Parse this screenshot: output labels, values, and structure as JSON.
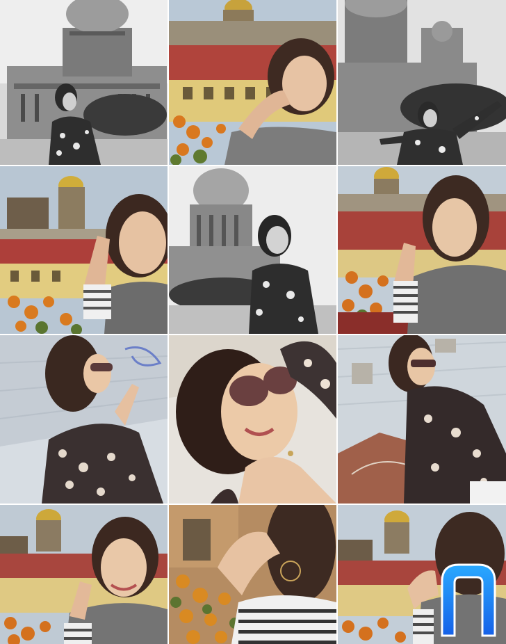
{
  "gallery": {
    "tiles": [
      {
        "scene": "cathedral-bw",
        "tone": "grayscale"
      },
      {
        "scene": "rooftop-flowers-blur",
        "tone": "color"
      },
      {
        "scene": "cathedral-bw-cheer",
        "tone": "grayscale"
      },
      {
        "scene": "rooftop-dome-blur",
        "tone": "color"
      },
      {
        "scene": "cathedral-bw-smile",
        "tone": "grayscale"
      },
      {
        "scene": "rooftop-flowers-smile",
        "tone": "color"
      },
      {
        "scene": "roof-sunglasses",
        "tone": "color"
      },
      {
        "scene": "sunglasses-closeup",
        "tone": "color"
      },
      {
        "scene": "roof-sunglasses-lean",
        "tone": "color"
      },
      {
        "scene": "dome-smile",
        "tone": "color"
      },
      {
        "scene": "flowers-hand",
        "tone": "color"
      },
      {
        "scene": "dome-hands",
        "tone": "color"
      }
    ]
  },
  "brand": {
    "icon": "n-logo-icon",
    "accent": "#1e90ff"
  }
}
